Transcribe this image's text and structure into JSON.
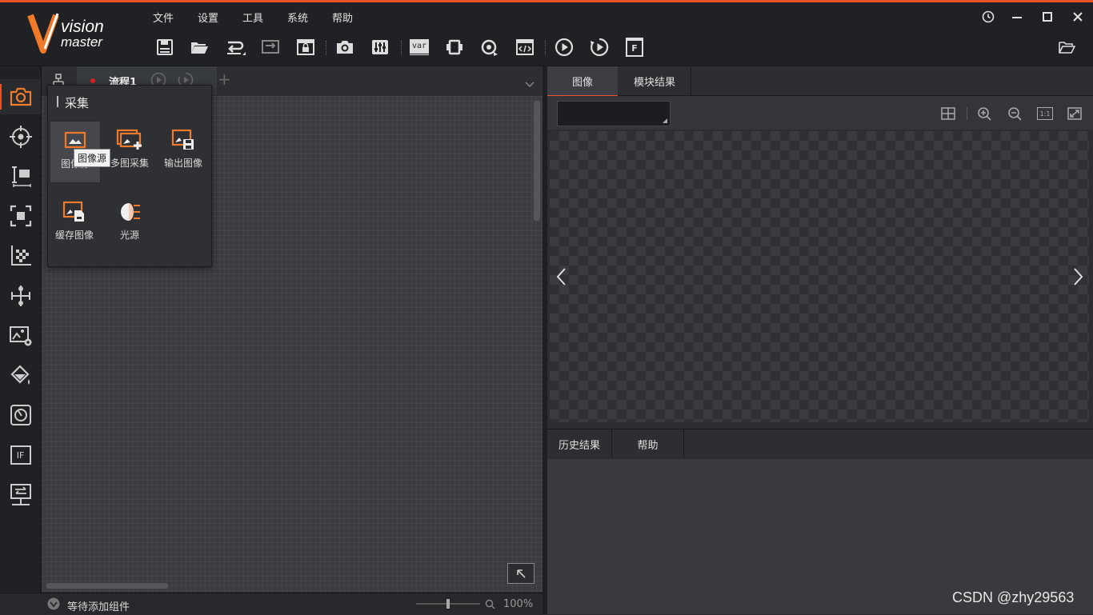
{
  "logo": {
    "line1": "vision",
    "line2": "master"
  },
  "menu": [
    "文件",
    "设置",
    "工具",
    "系统",
    "帮助"
  ],
  "window_controls": [
    "clock-icon",
    "minimize-icon",
    "maximize-icon",
    "close-icon"
  ],
  "toolbar": {
    "icons": [
      "save-icon",
      "open-folder-icon",
      "undo-icon",
      "redo-icon",
      "lock-icon",
      "camera-icon",
      "controls-icon",
      "var-icon",
      "device-icon",
      "loop-icon",
      "script-icon",
      "run-once-icon",
      "run-continuous-icon",
      "f-icon"
    ],
    "var_label": "var",
    "f_label": "F"
  },
  "sidebar": {
    "items": [
      "acquisition-icon",
      "locate-icon",
      "measure-icon",
      "recognize-icon",
      "calibrate-icon",
      "align-icon",
      "image-process-icon",
      "color-icon",
      "defect-icon",
      "logic-icon",
      "communication-icon"
    ],
    "if_label": "IF",
    "expand_label": "▸▸"
  },
  "flow": {
    "tab_label": "流程1",
    "add_label": "+"
  },
  "popup": {
    "title": "采集",
    "tools": [
      {
        "label": "图像源"
      },
      {
        "label": "多图采集"
      },
      {
        "label": "输出图像"
      },
      {
        "label": "缓存图像"
      },
      {
        "label": "光源"
      }
    ],
    "tooltip": "图像源"
  },
  "image_panel": {
    "tabs": [
      "图像",
      "模块结果"
    ],
    "one_to_one": "1:1",
    "combo_value": ""
  },
  "history_panel": {
    "tabs": [
      "历史结果",
      "帮助"
    ]
  },
  "status": {
    "text": "等待添加组件",
    "zoom": "100%",
    "zoom_slider_level": 0.5
  },
  "watermark": "CSDN @zhy29563",
  "colors": {
    "accent": "#e8542a",
    "icon_orange": "#f07a2a"
  }
}
